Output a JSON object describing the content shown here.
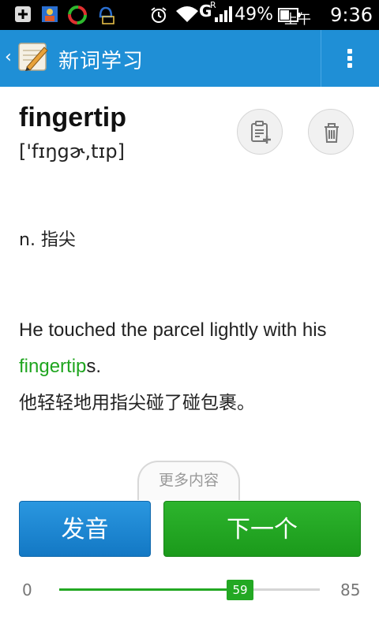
{
  "status_bar": {
    "battery": "49%",
    "ampm": "上午",
    "time": "9:36",
    "network": "G",
    "roaming": "R"
  },
  "action_bar": {
    "title": "新词学习",
    "brand_color": "#1f8fd6"
  },
  "word": {
    "term": "fingertip",
    "phonetic": "['fɪŋgɚ,tɪp]",
    "definition": "n. 指尖"
  },
  "example": {
    "en_before": "He touched the parcel lightly with his ",
    "en_highlight": "fingertip",
    "en_after": "s.",
    "zh": "他轻轻地用指尖碰了碰包裹。",
    "highlight_color": "#1fa51f"
  },
  "more_label": "更多内容",
  "buttons": {
    "pronounce": "发音",
    "next": "下一个"
  },
  "progress": {
    "min": "0",
    "max": "85",
    "current": "59",
    "value": 59,
    "max_value": 85
  }
}
